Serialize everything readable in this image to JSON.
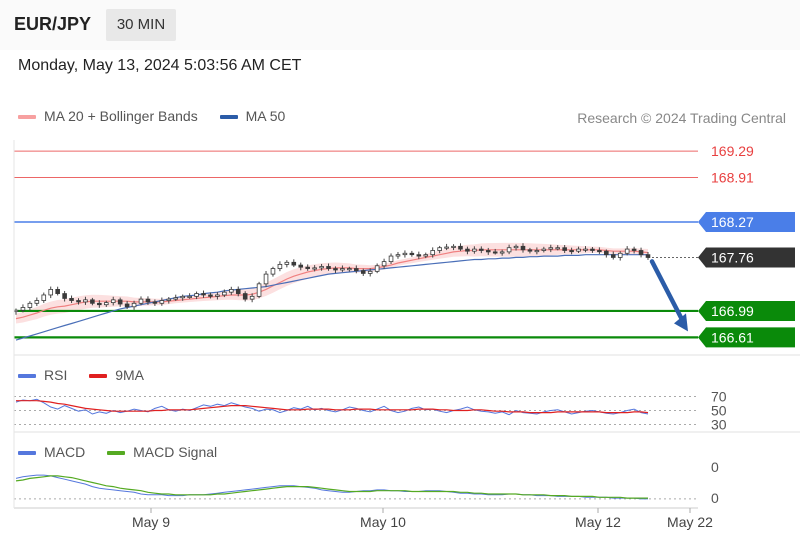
{
  "header": {
    "symbol": "EUR/JPY",
    "interval": "30 MIN"
  },
  "datetime": "Monday, May 13, 2024 5:03:56 AM CET",
  "legend": {
    "price": [
      {
        "label": "MA 20 + Bollinger Bands",
        "color": "#f08080"
      },
      {
        "label": "MA 50",
        "color": "#2b5ca8"
      }
    ],
    "rsi": [
      {
        "label": "RSI",
        "color": "#5577dd"
      },
      {
        "label": "9MA",
        "color": "#e02020"
      }
    ],
    "macd": [
      {
        "label": "MACD",
        "color": "#5577dd"
      },
      {
        "label": "MACD Signal",
        "color": "#55aa22"
      }
    ]
  },
  "credit": "Research © 2024 Trading Central",
  "chart_data": [
    {
      "type": "candlestick",
      "title": "EUR/JPY 30 MIN",
      "ylim": [
        166.5,
        169.45
      ],
      "x_ticks": [
        "May 9",
        "May 10",
        "May 12",
        "May 22"
      ],
      "levels": [
        {
          "value": 169.29,
          "label": "169.29",
          "color": "#e84040",
          "style": "resistance"
        },
        {
          "value": 168.91,
          "label": "168.91",
          "color": "#e84040",
          "style": "resistance"
        },
        {
          "value": 168.27,
          "label": "168.27",
          "color": "#4a7ee8",
          "style": "pivot"
        },
        {
          "value": 167.76,
          "label": "167.76",
          "color": "#333333",
          "style": "last"
        },
        {
          "value": 166.99,
          "label": "166.99",
          "color": "#0a8a0a",
          "style": "support"
        },
        {
          "value": 166.61,
          "label": "166.61",
          "color": "#0a8a0a",
          "style": "support"
        }
      ],
      "close_series": [
        167.0,
        167.04,
        167.1,
        167.14,
        167.22,
        167.3,
        167.24,
        167.17,
        167.14,
        167.12,
        167.15,
        167.1,
        167.08,
        167.11,
        167.15,
        167.09,
        167.05,
        167.1,
        167.16,
        167.12,
        167.1,
        167.14,
        167.16,
        167.18,
        167.2,
        167.2,
        167.24,
        167.22,
        167.2,
        167.22,
        167.26,
        167.3,
        167.24,
        167.16,
        167.2,
        167.38,
        167.52,
        167.6,
        167.66,
        167.69,
        167.65,
        167.62,
        167.6,
        167.61,
        167.63,
        167.6,
        167.58,
        167.6,
        167.6,
        167.57,
        167.53,
        167.56,
        167.64,
        167.7,
        167.78,
        167.8,
        167.82,
        167.8,
        167.78,
        167.8,
        167.86,
        167.9,
        167.91,
        167.92,
        167.88,
        167.85,
        167.88,
        167.86,
        167.84,
        167.83,
        167.84,
        167.9,
        167.92,
        167.87,
        167.85,
        167.86,
        167.88,
        167.9,
        167.9,
        167.86,
        167.85,
        167.88,
        167.88,
        167.86,
        167.85,
        167.8,
        167.76,
        167.82,
        167.88,
        167.86,
        167.8,
        167.76
      ],
      "ma20": [
        166.88,
        166.9,
        166.93,
        166.96,
        167.0,
        167.03,
        167.05,
        167.06,
        167.08,
        167.1,
        167.12,
        167.13,
        167.13,
        167.13,
        167.13,
        167.13,
        167.13,
        167.12,
        167.12,
        167.12,
        167.12,
        167.12,
        167.13,
        167.14,
        167.15,
        167.16,
        167.17,
        167.18,
        167.19,
        167.2,
        167.21,
        167.22,
        167.22,
        167.22,
        167.23,
        167.26,
        167.3,
        167.35,
        167.4,
        167.45,
        167.49,
        167.52,
        167.55,
        167.57,
        167.59,
        167.6,
        167.61,
        167.61,
        167.61,
        167.6,
        167.6,
        167.6,
        167.61,
        167.63,
        167.65,
        167.68,
        167.7,
        167.72,
        167.74,
        167.76,
        167.78,
        167.8,
        167.82,
        167.84,
        167.85,
        167.86,
        167.86,
        167.87,
        167.87,
        167.87,
        167.87,
        167.87,
        167.87,
        167.87,
        167.87,
        167.87,
        167.87,
        167.87,
        167.87,
        167.87,
        167.87,
        167.87,
        167.87,
        167.87,
        167.87,
        167.86,
        167.85,
        167.85,
        167.85,
        167.85,
        167.84,
        167.83
      ],
      "ma50": [
        166.57,
        166.6,
        166.63,
        166.66,
        166.69,
        166.72,
        166.75,
        166.78,
        166.81,
        166.84,
        166.87,
        166.9,
        166.93,
        166.96,
        166.99,
        167.02,
        167.04,
        167.06,
        167.08,
        167.1,
        167.12,
        167.14,
        167.16,
        167.18,
        167.2,
        167.21,
        167.22,
        167.24,
        167.25,
        167.26,
        167.28,
        167.29,
        167.3,
        167.31,
        167.32,
        167.33,
        167.34,
        167.36,
        167.38,
        167.4,
        167.42,
        167.44,
        167.46,
        167.48,
        167.5,
        167.52,
        167.53,
        167.54,
        167.55,
        167.56,
        167.57,
        167.58,
        167.59,
        167.6,
        167.61,
        167.62,
        167.63,
        167.64,
        167.65,
        167.66,
        167.67,
        167.68,
        167.69,
        167.7,
        167.71,
        167.72,
        167.73,
        167.73,
        167.74,
        167.74,
        167.75,
        167.75,
        167.76,
        167.76,
        167.77,
        167.77,
        167.78,
        167.78,
        167.78,
        167.79,
        167.79,
        167.79,
        167.8,
        167.8,
        167.8,
        167.8,
        167.8,
        167.8,
        167.8,
        167.8,
        167.8,
        167.8
      ],
      "forecast": {
        "from": 167.76,
        "to": 166.61
      }
    },
    {
      "type": "line",
      "title": "RSI",
      "ylim": [
        25,
        75
      ],
      "y_ticks": [
        "70",
        "50",
        "30"
      ],
      "series": [
        {
          "name": "RSI",
          "values": [
            62,
            65,
            64,
            66,
            61,
            55,
            52,
            57,
            53,
            49,
            51,
            45,
            48,
            46,
            50,
            47,
            49,
            52,
            50,
            48,
            53,
            56,
            51,
            49,
            52,
            50,
            54,
            58,
            56,
            59,
            57,
            61,
            58,
            55,
            53,
            49,
            52,
            51,
            47,
            50,
            54,
            52,
            56,
            51,
            53,
            50,
            48,
            51,
            55,
            53,
            50,
            48,
            52,
            56,
            50,
            47,
            49,
            53,
            55,
            51,
            52,
            49,
            47,
            50,
            52,
            55,
            51,
            49,
            48,
            46,
            48,
            44,
            50,
            47,
            46,
            45,
            48,
            50,
            51,
            48,
            45,
            47,
            49,
            50,
            48,
            46,
            45,
            47,
            50,
            52,
            47,
            45
          ]
        },
        {
          "name": "9MA",
          "values": [
            64,
            64,
            64,
            64,
            63,
            62,
            60,
            59,
            57,
            55,
            53,
            52,
            51,
            50,
            49,
            49,
            49,
            49,
            49,
            49,
            50,
            50,
            51,
            51,
            51,
            51,
            52,
            53,
            54,
            55,
            56,
            57,
            57,
            57,
            56,
            55,
            54,
            53,
            52,
            51,
            51,
            51,
            52,
            52,
            52,
            52,
            51,
            51,
            51,
            52,
            52,
            52,
            51,
            51,
            51,
            51,
            51,
            51,
            52,
            52,
            52,
            51,
            51,
            50,
            50,
            50,
            51,
            51,
            50,
            49,
            49,
            48,
            48,
            48,
            47,
            47,
            47,
            47,
            48,
            48,
            48,
            48,
            48,
            48,
            48,
            47,
            47,
            47,
            47,
            48,
            48,
            47
          ]
        }
      ]
    },
    {
      "type": "line",
      "title": "MACD",
      "ylim": [
        -0.05,
        0.45
      ],
      "y_ticks": [
        "0",
        "0"
      ],
      "series": [
        {
          "name": "MACD",
          "values": [
            0.25,
            0.27,
            0.28,
            0.29,
            0.29,
            0.28,
            0.26,
            0.24,
            0.22,
            0.2,
            0.18,
            0.15,
            0.13,
            0.12,
            0.11,
            0.1,
            0.09,
            0.08,
            0.06,
            0.05,
            0.05,
            0.05,
            0.04,
            0.04,
            0.04,
            0.05,
            0.05,
            0.05,
            0.06,
            0.07,
            0.08,
            0.09,
            0.1,
            0.11,
            0.12,
            0.13,
            0.14,
            0.15,
            0.16,
            0.16,
            0.16,
            0.15,
            0.14,
            0.13,
            0.11,
            0.1,
            0.09,
            0.08,
            0.08,
            0.09,
            0.1,
            0.1,
            0.11,
            0.11,
            0.1,
            0.1,
            0.09,
            0.09,
            0.09,
            0.1,
            0.1,
            0.1,
            0.09,
            0.08,
            0.07,
            0.07,
            0.06,
            0.06,
            0.05,
            0.05,
            0.05,
            0.06,
            0.06,
            0.05,
            0.05,
            0.04,
            0.04,
            0.04,
            0.03,
            0.03,
            0.03,
            0.03,
            0.02,
            0.02,
            0.02,
            0.02,
            0.01,
            0.01,
            0.01,
            0.01,
            0.0,
            0.0
          ]
        },
        {
          "name": "MACD Signal",
          "values": [
            0.22,
            0.23,
            0.25,
            0.26,
            0.27,
            0.28,
            0.28,
            0.27,
            0.26,
            0.24,
            0.22,
            0.2,
            0.18,
            0.16,
            0.15,
            0.13,
            0.12,
            0.11,
            0.1,
            0.08,
            0.07,
            0.06,
            0.06,
            0.05,
            0.05,
            0.05,
            0.05,
            0.05,
            0.05,
            0.06,
            0.06,
            0.07,
            0.08,
            0.09,
            0.1,
            0.11,
            0.12,
            0.13,
            0.14,
            0.15,
            0.15,
            0.15,
            0.15,
            0.14,
            0.13,
            0.12,
            0.11,
            0.1,
            0.09,
            0.09,
            0.09,
            0.09,
            0.1,
            0.1,
            0.1,
            0.1,
            0.1,
            0.09,
            0.09,
            0.09,
            0.09,
            0.09,
            0.09,
            0.09,
            0.08,
            0.08,
            0.07,
            0.07,
            0.06,
            0.06,
            0.06,
            0.06,
            0.06,
            0.05,
            0.05,
            0.05,
            0.05,
            0.04,
            0.04,
            0.04,
            0.03,
            0.03,
            0.03,
            0.03,
            0.02,
            0.02,
            0.02,
            0.02,
            0.01,
            0.01,
            0.01,
            0.01
          ]
        }
      ]
    }
  ]
}
